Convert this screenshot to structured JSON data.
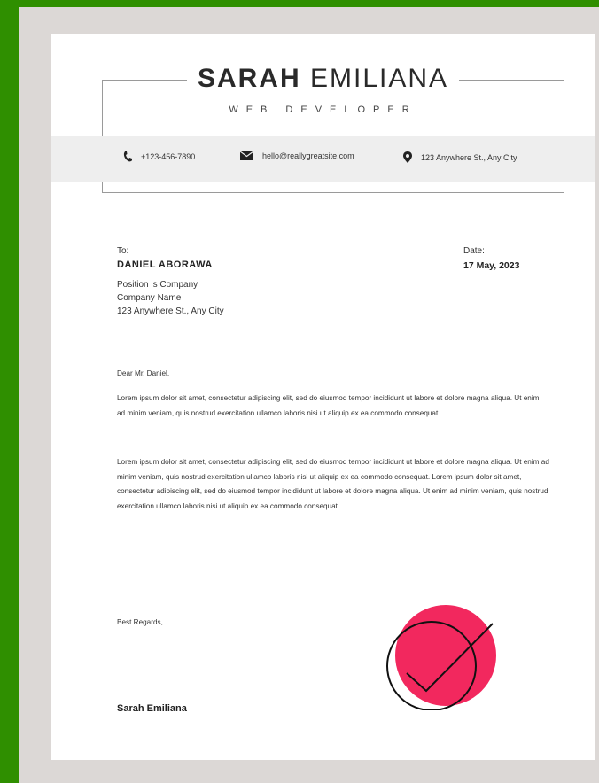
{
  "header": {
    "first_name": "SARAH",
    "last_name": "EMILIANA",
    "role": "WEB DEVELOPER"
  },
  "contact": {
    "phone": "+123-456-7890",
    "email": "hello@reallygreatsite.com",
    "address": "123 Anywhere St., Any City"
  },
  "recipient": {
    "to_label": "To:",
    "name": "DANIEL ABORAWA",
    "lines": [
      "Position is Company",
      "Company Name",
      "123 Anywhere St., Any City"
    ]
  },
  "date": {
    "label": "Date:",
    "value": "17 May, 2023"
  },
  "letter": {
    "salutation": "Dear Mr. Daniel,",
    "paragraph1": "Lorem ipsum dolor sit amet, consectetur adipiscing elit, sed do eiusmod tempor incididunt ut labore et dolore magna aliqua. Ut enim ad minim veniam, quis nostrud exercitation ullamco laboris nisi ut aliquip ex ea commodo consequat.",
    "paragraph2": "Lorem ipsum dolor sit amet, consectetur adipiscing elit, sed do eiusmod tempor incididunt ut labore et dolore magna aliqua. Ut enim ad minim veniam, quis nostrud exercitation ullamco laboris nisi ut aliquip ex ea commodo consequat. Lorem ipsum dolor sit amet, consectetur adipiscing elit, sed do eiusmod tempor incididunt ut labore et dolore magna aliqua. Ut enim ad minim veniam, quis nostrud exercitation ullamco laboris nisi ut aliquip ex ea commodo consequat.",
    "closing": "Best Regards,",
    "signature": "Sarah Emiliana"
  },
  "colors": {
    "outer_background": "#2f8f00",
    "frame": "#dcd8d6",
    "accent_circle": "#f2285e"
  },
  "icons": [
    "phone-icon",
    "email-icon",
    "location-pin-icon",
    "checkmark-icon"
  ]
}
